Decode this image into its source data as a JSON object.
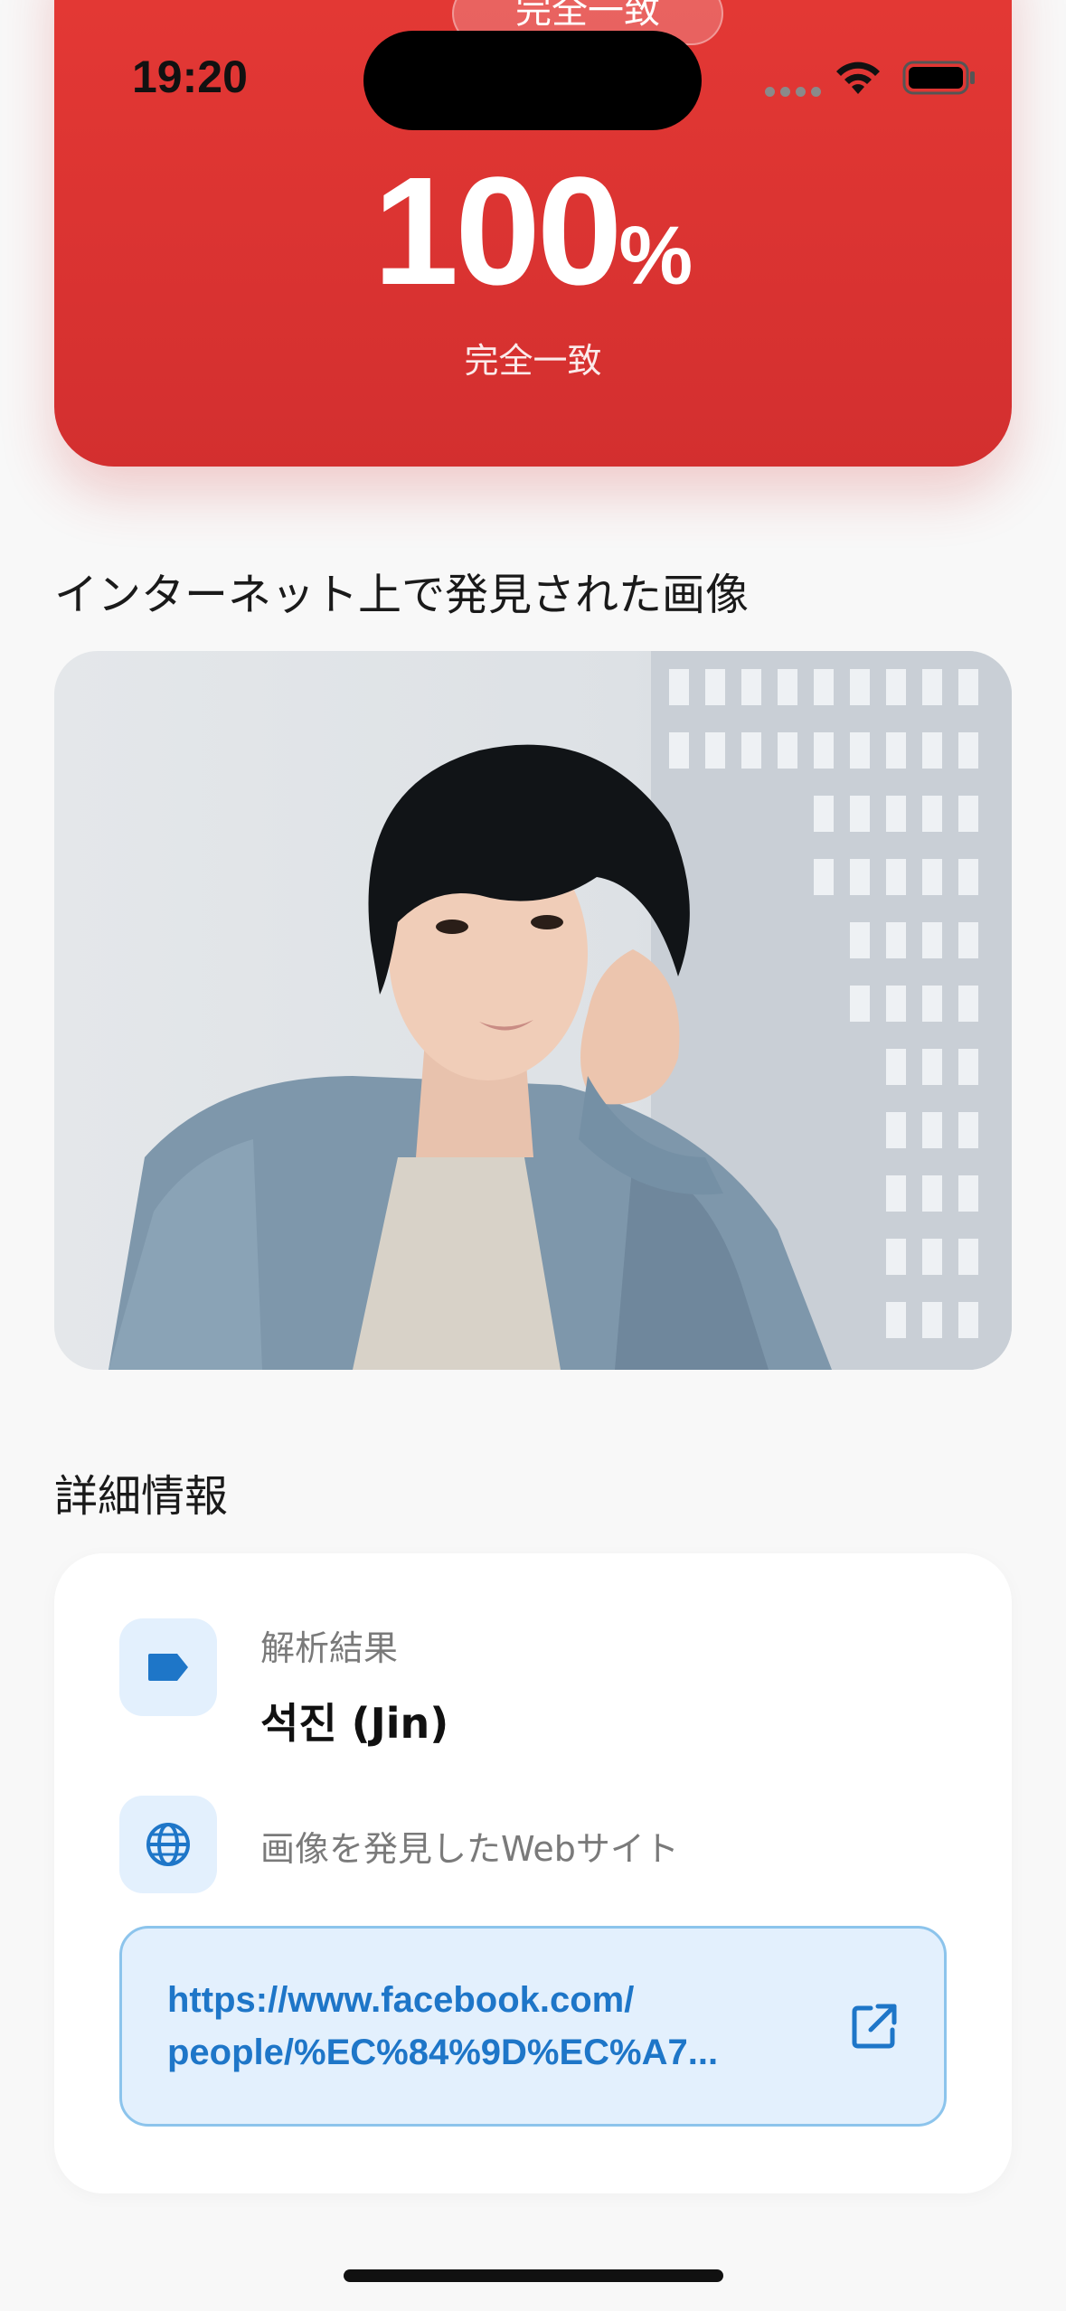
{
  "hero": {
    "pill_label": "完全一致",
    "match_value": "100",
    "match_unit": "%",
    "match_label": "完全一致",
    "accent_color": "#d32f2f"
  },
  "status_bar": {
    "time": "19:20",
    "icons": [
      "cellular-signal-icon",
      "wifi-icon",
      "battery-icon"
    ]
  },
  "found_images": {
    "title": "インターネット上で発見された画像"
  },
  "details": {
    "title": "詳細情報",
    "analysis": {
      "icon": "tag-icon",
      "label": "解析結果",
      "value": "석진 (Jin)"
    },
    "website": {
      "icon": "globe-icon",
      "label": "画像を発見したWebサイト",
      "url": "https://www.facebook.com/\npeople/%EC%84%9D%EC%A7...",
      "open_icon": "open-in-new-icon"
    },
    "link_color": "#1e76c8"
  }
}
